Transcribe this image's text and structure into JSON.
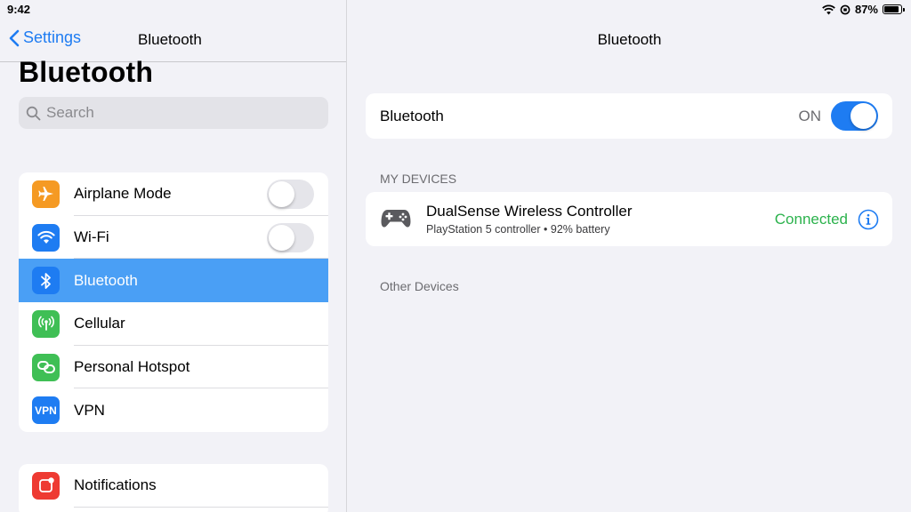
{
  "status_bar": {
    "time": "9:42",
    "battery_percent": "87%",
    "battery_level": 0.87
  },
  "sidebar": {
    "back_label": "Settings",
    "nav_title": "Bluetooth",
    "large_title": "Bluetooth",
    "search": {
      "placeholder": "Search"
    },
    "items": [
      {
        "label": "Airplane Mode",
        "icon": "airplane-icon",
        "icon_color": "#f59a23",
        "toggle": "off"
      },
      {
        "label": "Wi-Fi",
        "icon": "wifi-icon",
        "icon_color": "#1e7cf2",
        "toggle": "off"
      },
      {
        "label": "Bluetooth",
        "icon": "bluetooth-icon",
        "icon_color": "#1e7cf2",
        "selected": true
      },
      {
        "label": "Cellular",
        "icon": "cellular-antenna-icon",
        "icon_color": "#3fbf55"
      },
      {
        "label": "Personal Hotspot",
        "icon": "hotspot-link-icon",
        "icon_color": "#3fbf55"
      },
      {
        "label": "VPN",
        "icon": "vpn-icon",
        "icon_color": "#1e7cf2",
        "icon_text": "VPN"
      }
    ],
    "items_group2": [
      {
        "label": "Notifications",
        "icon": "notifications-icon",
        "icon_color": "#ee3a32"
      }
    ]
  },
  "detail": {
    "title": "Bluetooth",
    "bluetooth_row": {
      "label": "Bluetooth",
      "state_text": "ON",
      "toggle": "on"
    },
    "my_devices_header": "My Devices",
    "devices": [
      {
        "name": "DualSense Wireless Controller",
        "subtitle": "PlayStation 5 controller • 92% battery",
        "status": "Connected",
        "icon": "game-controller-icon"
      }
    ],
    "other_devices_header": "Other Devices"
  },
  "colors": {
    "accent": "#1e7cf2",
    "selected_row": "#4a9ff5",
    "connected": "#2bb24c",
    "background": "#f2f2f7"
  }
}
